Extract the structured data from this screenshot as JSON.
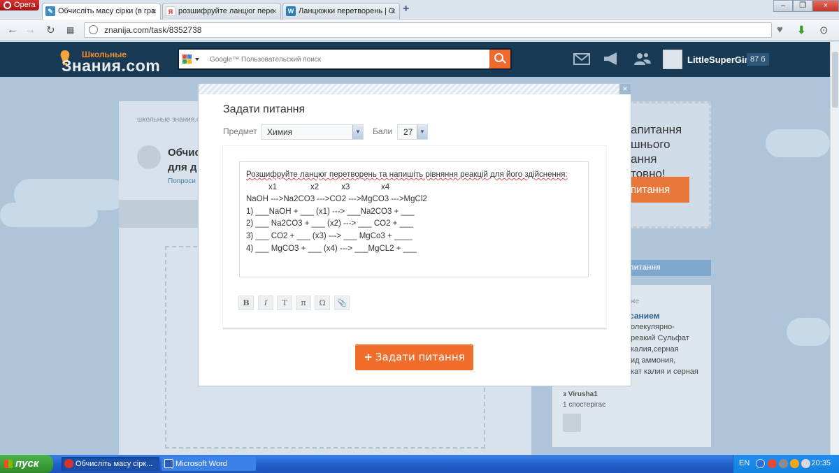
{
  "browser": {
    "menu_label": "Opera",
    "tabs": [
      {
        "label": "Обчисліть масу сірки (в гра"
      },
      {
        "label": "розшифруйте ланцюг пере"
      },
      {
        "label": "Ланцюжки перетворень | О"
      }
    ],
    "url": "znanija.com/task/8352738"
  },
  "site": {
    "logo_small": "Школьные",
    "logo_big": "Знания.com",
    "search_placeholder": "Google™ Пользовательский поиск",
    "username": "LittleSuperGirl",
    "points_badge": "87 б"
  },
  "background": {
    "breadcrumb": "школьные знания.co",
    "question_title": "Обчис для д",
    "ask_link": "Попроси п",
    "promo_lines": [
      "апитання",
      "шнього",
      "ання",
      "товно!"
    ],
    "promo_button": "питання",
    "side_tab": "питання",
    "side_small": "же",
    "side_link": "санием",
    "side_lines": [
      "олекулярно-",
      "реакий Сульфат",
      "калия,серная",
      "ид аммония,",
      "кат калия и серная"
    ],
    "side_author": "з Virusha1",
    "side_watchers": "1 спостерігає"
  },
  "modal": {
    "title": "Задати питання",
    "subject_label": "Предмет",
    "subject_value": "Химия",
    "points_label": "Бали",
    "points_value": "27",
    "question_lines": [
      "Розшифруйте ланцюг перетворень та напишіть рівняння реакцій для його здійснення:",
      "          x1               x2          x3              x4",
      "NaOH --->Na2CO3 --->CO2 --->MgCO3 --->MgCl2",
      "1) ___NaOH + ___ (x1) ---> ___Na2CO3 + ___",
      "2) ___ Na2CO3 + ___ (x2) ---> ___ CO2 + ___",
      "3) ___ CO2 + ___ (x3) ---> ___ MgCo3 + ____",
      "4) ___ MgCO3 + ___ (x4) ---> ___MgCL2 + ___"
    ],
    "toolbar": [
      "B",
      "I",
      "T",
      "π",
      "Ω",
      "📎"
    ],
    "submit_label": "Задати питання",
    "close_glyph": "×"
  },
  "taskbar": {
    "start_label": "пуск",
    "tasks": [
      {
        "label": "Обчисліть масу сірк..."
      },
      {
        "label": "Microsoft Word"
      }
    ],
    "language": "EN",
    "clock": "20:35"
  }
}
